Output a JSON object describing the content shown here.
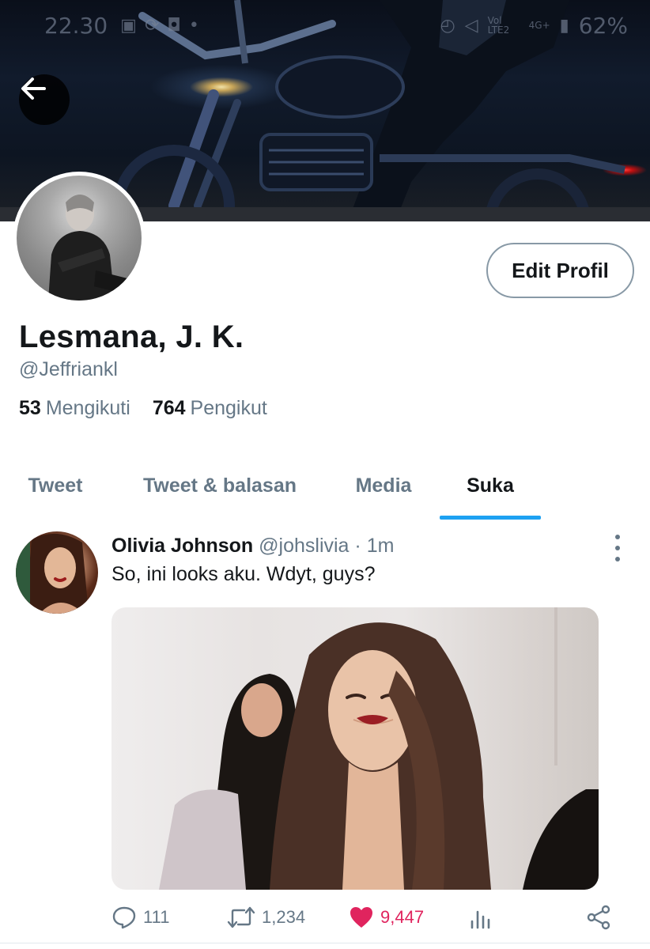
{
  "status_bar": {
    "time": "22.30",
    "network": "Vol LTE2",
    "network_type": "4G+",
    "battery": "62%"
  },
  "profile": {
    "display_name": "Lesmana, J. K.",
    "handle": "@Jeffriankl",
    "edit_button_label": "Edit Profil",
    "following_count": "53",
    "following_label": "Mengikuti",
    "followers_count": "764",
    "followers_label": "Pengikut"
  },
  "tabs": [
    {
      "label": "Tweet",
      "active": false
    },
    {
      "label": "Tweet & balasan",
      "active": false
    },
    {
      "label": "Media",
      "active": false
    },
    {
      "label": "Suka",
      "active": true
    }
  ],
  "tweet": {
    "author_name": "Olivia Johnson",
    "author_handle": "@johslivia",
    "separator": "·",
    "time": "1m",
    "text": "So, ini looks aku. Wdyt, guys?",
    "replies": "111",
    "retweets": "1,234",
    "likes": "9,447",
    "liked": true
  },
  "colors": {
    "accent": "#1da1f2",
    "secondary_text": "#657786",
    "like": "#e0245e",
    "primary_text": "#14171a"
  },
  "icons": {
    "back": "arrow-left-icon",
    "more": "more-vertical-icon",
    "reply": "reply-icon",
    "retweet": "retweet-icon",
    "like": "heart-icon",
    "analytics": "analytics-icon",
    "share": "share-icon"
  }
}
